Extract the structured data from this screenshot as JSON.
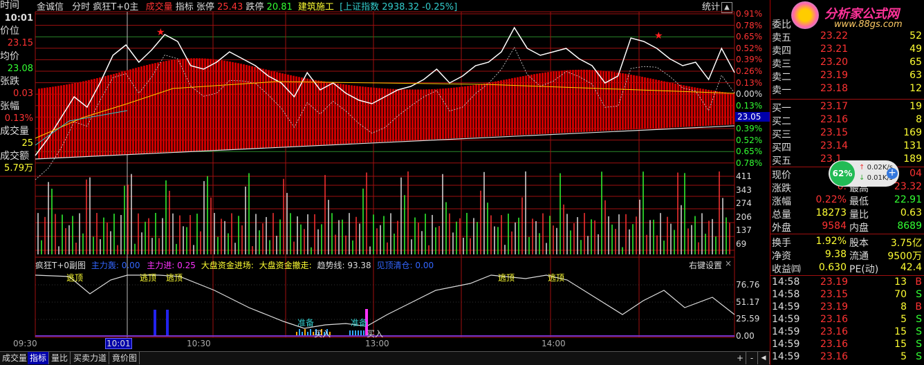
{
  "left_panel": {
    "time_label": "时间",
    "time_value": "10:01",
    "price_label": "价位",
    "price_value": "23.15",
    "avg_label": "均价",
    "avg_value": "23.08",
    "change_label": "张跌",
    "change_value": "0.03",
    "pct_label": "张幅",
    "pct_value": "0.13%",
    "vol_label": "成交量",
    "vol_value": "25",
    "amt_label": "成交额",
    "amt_value": "5.79万"
  },
  "header": {
    "name": "金诚信",
    "mode": "分时",
    "indicator": "疯狂T+0主",
    "volume": "成交量",
    "index_btn": "指标",
    "limit_up_label": "张停",
    "limit_up": "25.43",
    "limit_down_label": "跌停",
    "limit_down": "20.81",
    "sector": "建筑施工",
    "market": "[上证指数",
    "market_value": "2938.32 -0.25%]",
    "stats_btn": "统计"
  },
  "price_axis_right": [
    "0.91%",
    "0.78%",
    "0.65%",
    "0.52%",
    "0.39%",
    "0.26%",
    "0.13%",
    "0.00%",
    "0.13%",
    "0.26%",
    "0.39%",
    "0.52%",
    "0.65%",
    "0.78%"
  ],
  "current_price_tag": "23.05",
  "volume_axis": [
    "411",
    "343",
    "274",
    "206",
    "137",
    "69"
  ],
  "subchart": {
    "title": "疯狂T+0副图",
    "zl_label": "主力轰:",
    "zl_value": "0.00",
    "zlj_label": "主力进:",
    "zlj_value": "0.25",
    "dpin_label": "大盘资金进场:",
    "dpout_label": "大盘资金撤走:",
    "trend_label": "趋势线:",
    "trend_value": "93.38",
    "top_label": "见顶清仓:",
    "top_value": "0.00",
    "settings": "右键设置",
    "close": "×",
    "axis": [
      "76.76",
      "51.17",
      "25.59",
      "0.00"
    ],
    "signals": [
      "逃顶",
      "逃顶",
      "逃顶",
      "逃顶",
      "逃顶",
      "准备",
      "准备",
      "买入",
      "买入"
    ]
  },
  "time_axis": {
    "labels": [
      "09:30",
      "10:01",
      "10:30",
      "13:00",
      "14:00"
    ]
  },
  "tabs": [
    "成交量",
    "指标",
    "量比",
    "买卖力道",
    "竟价图"
  ],
  "tabs_right": [
    "+",
    "-"
  ],
  "right_panel": {
    "logo_title": "分析家公式网",
    "logo_url": "www.88gs.com",
    "weibi_label": "委比",
    "sell": [
      {
        "label": "卖五",
        "price": "23.22",
        "vol": "52"
      },
      {
        "label": "卖四",
        "price": "23.21",
        "vol": "49"
      },
      {
        "label": "卖三",
        "price": "23.20",
        "vol": "65"
      },
      {
        "label": "卖二",
        "price": "23.19",
        "vol": "63"
      },
      {
        "label": "卖一",
        "price": "23.18",
        "vol": "12"
      }
    ],
    "buy": [
      {
        "label": "买一",
        "price": "23.17",
        "vol": "19"
      },
      {
        "label": "买二",
        "price": "23.16",
        "vol": "8"
      },
      {
        "label": "买三",
        "price": "23.15",
        "vol": "169"
      },
      {
        "label": "买四",
        "price": "23.14",
        "vol": "131"
      },
      {
        "label": "买五",
        "price": "23.1",
        "vol": "189"
      }
    ],
    "quote": [
      {
        "l1": "现价",
        "v1": "2",
        "l2": "",
        "v2": "04"
      },
      {
        "l1": "涨跌",
        "v1": "0.",
        "l2": "最高",
        "v2": "23.32"
      },
      {
        "l1": "涨幅",
        "v1": "0.22%",
        "l2": "最低",
        "v2": "22.91"
      },
      {
        "l1": "总量",
        "v1": "18273",
        "l2": "量比",
        "v2": "0.63"
      },
      {
        "l1": "外盘",
        "v1": "9584",
        "l2": "内盘",
        "v2": "8689"
      }
    ],
    "fund": [
      {
        "l1": "换手",
        "v1": "1.92%",
        "l2": "股本",
        "v2": "3.75亿"
      },
      {
        "l1": "净资",
        "v1": "9.38",
        "l2": "流通",
        "v2": "9500万"
      },
      {
        "l1": "收益㈣",
        "v1": "0.630",
        "l2": "PE(动)",
        "v2": "42.4"
      }
    ],
    "ticks": [
      {
        "time": "14:58",
        "price": "23.19",
        "vol": "13",
        "side": "B"
      },
      {
        "time": "14:58",
        "price": "23.15",
        "vol": "70",
        "side": "S"
      },
      {
        "time": "14:59",
        "price": "23.19",
        "vol": "8",
        "side": "B"
      },
      {
        "time": "14:59",
        "price": "23.16",
        "vol": "5",
        "side": "S"
      },
      {
        "time": "14:59",
        "price": "23.16",
        "vol": "15",
        "side": "S"
      },
      {
        "time": "14:59",
        "price": "23.16",
        "vol": "15",
        "side": "S"
      },
      {
        "time": "14:59",
        "price": "23.16",
        "vol": "5",
        "side": "S"
      }
    ]
  },
  "badge": {
    "percent": "62%",
    "up": "0.02K/s",
    "down": "0.01K/s",
    "plus": "+"
  },
  "colors": {
    "up": "#ff3333",
    "down": "#33ff33",
    "grid": "#a01010",
    "bar_fill": "#cc0000"
  }
}
